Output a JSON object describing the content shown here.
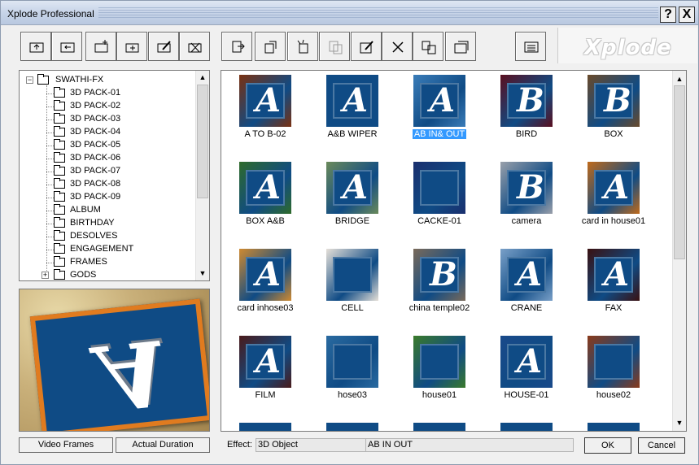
{
  "window": {
    "title": "Xplode Professional",
    "help_label": "?",
    "close_label": "X",
    "logo": "Xplode"
  },
  "toolbar": {
    "buttons": [
      {
        "icon": "folder-up-icon",
        "enabled": true
      },
      {
        "icon": "folder-back-icon",
        "enabled": true
      },
      {
        "icon": "new-folder-icon",
        "enabled": true
      },
      {
        "icon": "add-folder-icon",
        "enabled": true
      },
      {
        "icon": "edit-folder-icon",
        "enabled": true
      },
      {
        "icon": "delete-folder-icon",
        "enabled": true
      },
      {
        "icon": "import-icon",
        "enabled": true
      },
      {
        "icon": "export-icon",
        "enabled": true
      },
      {
        "icon": "copy-icon",
        "enabled": true
      },
      {
        "icon": "paste-icon",
        "enabled": false
      },
      {
        "icon": "edit-effect-icon",
        "enabled": true
      },
      {
        "icon": "delete-icon",
        "enabled": true
      },
      {
        "icon": "move-icon",
        "enabled": true
      },
      {
        "icon": "properties-icon",
        "enabled": true
      },
      {
        "icon": "details-view-icon",
        "enabled": true
      }
    ]
  },
  "tree": {
    "root": "SWATHI-FX",
    "items": [
      {
        "label": "3D PACK-01",
        "open": true
      },
      {
        "label": "3D PACK-02"
      },
      {
        "label": "3D PACK-03"
      },
      {
        "label": "3D PACK-04"
      },
      {
        "label": "3D PACK-05"
      },
      {
        "label": "3D PACK-06"
      },
      {
        "label": "3D PACK-07"
      },
      {
        "label": "3D PACK-08"
      },
      {
        "label": "3D PACK-09"
      },
      {
        "label": "ALBUM"
      },
      {
        "label": "BIRTHDAY"
      },
      {
        "label": "DESOLVES"
      },
      {
        "label": "ENGAGEMENT"
      },
      {
        "label": "FRAMES"
      },
      {
        "label": "GODS",
        "expandable": true
      }
    ]
  },
  "buttons": {
    "video_frames": "Video Frames",
    "actual_duration": "Actual Duration",
    "ok": "OK",
    "cancel": "Cancel"
  },
  "effects": [
    {
      "label": "A TO B-02",
      "letter": "A",
      "bg": "#7a3010"
    },
    {
      "label": "A&B WIPER",
      "letter": "A",
      "bg": "#0f4b85"
    },
    {
      "label": "AB IN& OUT",
      "letter": "A",
      "bg": "#3a7cb8",
      "selected": true
    },
    {
      "label": "BIRD",
      "letter": "B",
      "bg": "#5a0e1e"
    },
    {
      "label": "BOX",
      "letter": "B",
      "bg": "#6a4a2a"
    },
    {
      "label": "BOX A&B",
      "letter": "A",
      "bg": "#2f6b2a"
    },
    {
      "label": "BRIDGE",
      "letter": "A",
      "bg": "#6b8a5a"
    },
    {
      "label": "CACKE-01",
      "letter": "",
      "bg": "#1a2f6e"
    },
    {
      "label": "camera",
      "letter": "B",
      "bg": "#9aa0aa"
    },
    {
      "label": "card in house01",
      "letter": "A",
      "bg": "#c06a1a"
    },
    {
      "label": "card inhose03",
      "letter": "A",
      "bg": "#d08a30"
    },
    {
      "label": "CELL",
      "letter": "",
      "bg": "#e6e0d8"
    },
    {
      "label": "china temple02",
      "letter": "B",
      "bg": "#7a6a5a"
    },
    {
      "label": "CRANE",
      "letter": "A",
      "bg": "#7aa0c8"
    },
    {
      "label": "FAX",
      "letter": "A",
      "bg": "#3a1010"
    },
    {
      "label": "FILM",
      "letter": "A",
      "bg": "#4a1a1a"
    },
    {
      "label": "hose03",
      "letter": "",
      "bg": "#2a6aa0"
    },
    {
      "label": "house01",
      "letter": "",
      "bg": "#3a7a2a"
    },
    {
      "label": "HOUSE-01",
      "letter": "A",
      "bg": "#1a4a8a"
    },
    {
      "label": "house02",
      "letter": "",
      "bg": "#8a3a1a"
    }
  ],
  "status": {
    "effect_label": "Effect:",
    "effect_type": "3D Object",
    "effect_name": "AB IN OUT"
  }
}
